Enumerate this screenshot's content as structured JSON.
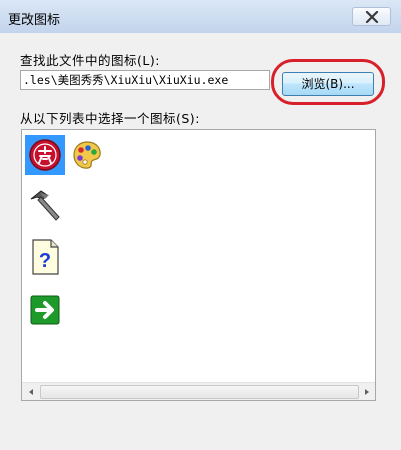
{
  "window": {
    "title": "更改图标",
    "close_icon": "close-icon"
  },
  "file_section": {
    "label": "查找此文件中的图标(L):",
    "path_value": ".les\\美图秀秀\\XiuXiu\\XiuXiu.exe",
    "browse_label": "浏览(B)..."
  },
  "list_section": {
    "label": "从以下列表中选择一个图标(S):",
    "icons": [
      {
        "name": "xiuxiu-logo-icon",
        "selected": true
      },
      {
        "name": "palette-icon",
        "selected": false
      },
      {
        "name": "hammer-icon",
        "selected": false
      },
      {
        "name": "help-document-icon",
        "selected": false
      },
      {
        "name": "green-arrow-icon",
        "selected": false
      }
    ]
  },
  "scrollbar": {
    "left_arrow": "scroll-left-arrow-icon",
    "right_arrow": "scroll-right-arrow-icon"
  },
  "colors": {
    "accent_selected": "#3399ff",
    "highlight_ring": "#d8202a"
  }
}
